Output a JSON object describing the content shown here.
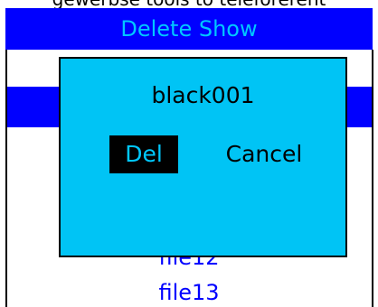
{
  "header": {
    "clipped_text": "gewerbse tools to teleforerent",
    "title": "Delete Show"
  },
  "file_list": {
    "items": [
      "file12",
      "file13"
    ]
  },
  "dialog": {
    "show_name": "black001",
    "delete_label": "Del",
    "cancel_label": "Cancel"
  },
  "colors": {
    "title_bar": "#0000ff",
    "title_text": "#00c8ff",
    "dialog_bg": "#00c4f5",
    "list_text": "#0000ff",
    "del_button_bg": "#000000"
  }
}
